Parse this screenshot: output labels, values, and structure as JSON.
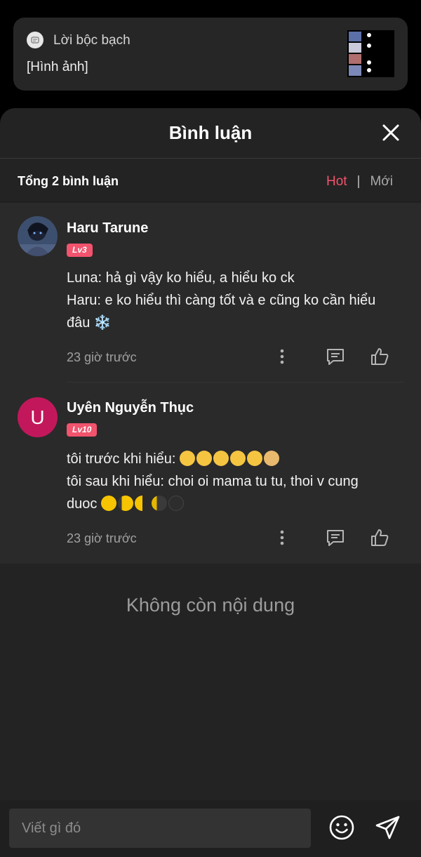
{
  "notification": {
    "app_name": "Lời bộc bạch",
    "body": "[Hình ảnh]",
    "app_icon": "message-bubble-icon"
  },
  "sheet": {
    "title": "Bình luận",
    "close_icon": "close-icon",
    "count_text": "Tổng 2 bình luận",
    "sort_hot": "Hot",
    "sort_sep": "|",
    "sort_new": "Mới",
    "no_more": "Không còn nội dung"
  },
  "comments": [
    {
      "name": "Haru Tarune",
      "level": "Lv3",
      "lines": [
        "Luna: hả gì vậy ko hiểu, a hiểu ko ck",
        "Haru: e ko hiểu thì càng tốt và e cũng ko cần hiểu",
        "đâu ❄️"
      ],
      "time": "23 giờ trước"
    },
    {
      "name": "Uyên Nguyễn Thục",
      "avatar_letter": "U",
      "level": "Lv10",
      "line1": "tôi trước khi hiểu: ",
      "line2": "tôi sau khi hiểu: choi oi mama tu tu, thoi v cung",
      "line3": "duoc ",
      "time": "23 giờ trước"
    }
  ],
  "input": {
    "placeholder": "Viết gì đó",
    "emoji_icon": "smiley-icon",
    "send_icon": "send-icon"
  },
  "colors": {
    "accent": "#f2536d",
    "sheet_bg": "#232323",
    "comment_bg": "#2a2a2a",
    "avatar_u": "#c2185b"
  }
}
